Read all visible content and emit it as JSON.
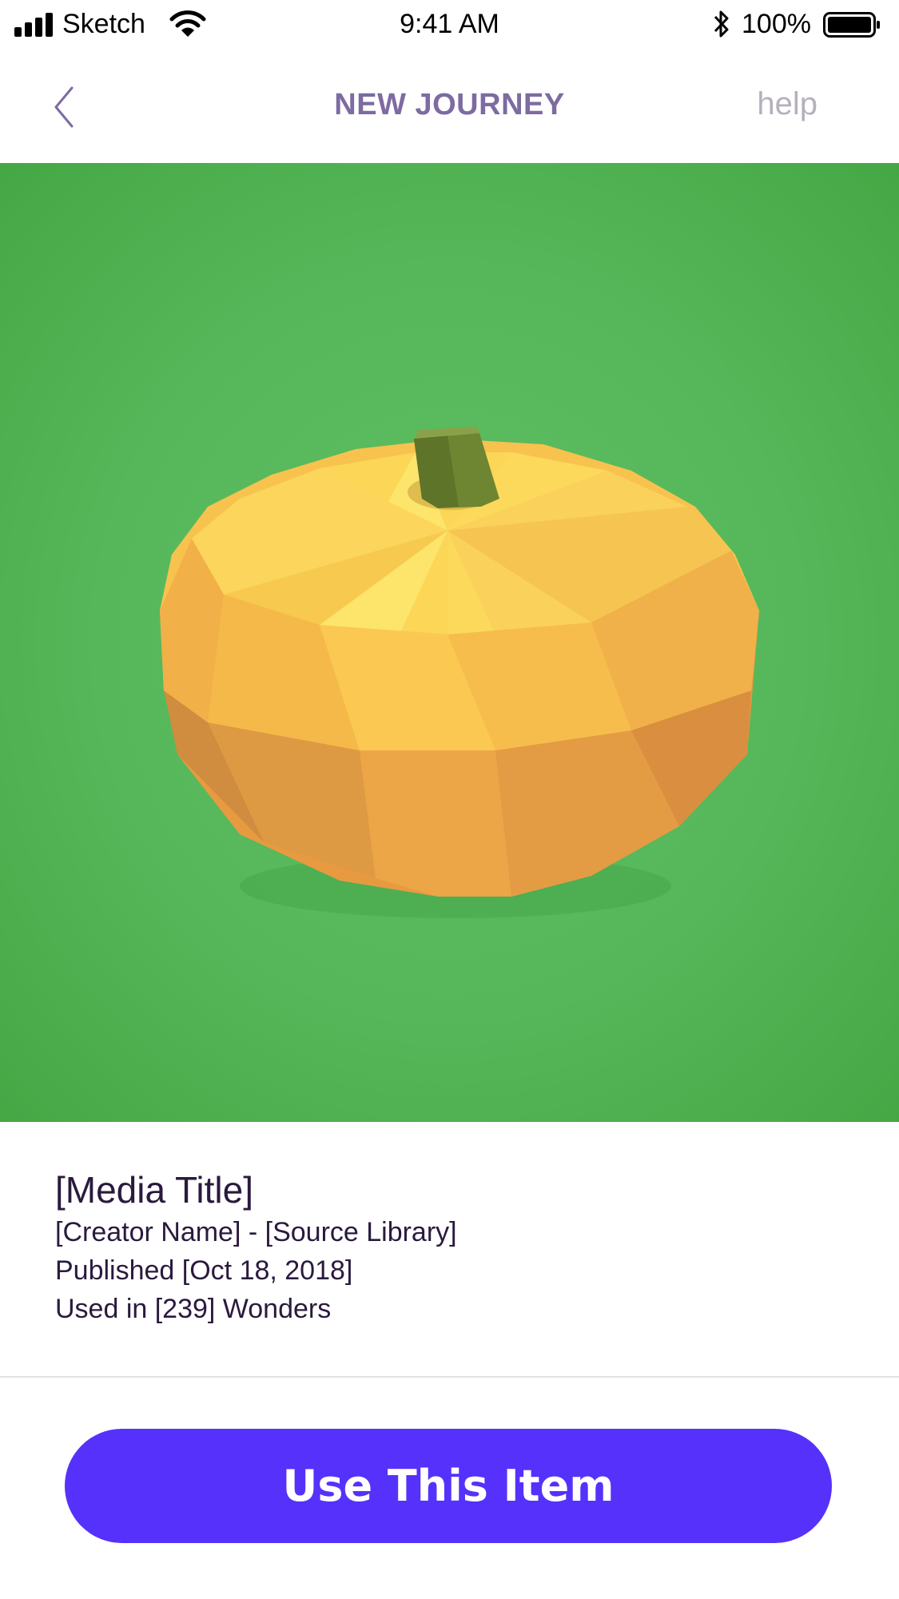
{
  "status_bar": {
    "carrier": "Sketch",
    "time": "9:41 AM",
    "battery_percent": "100%",
    "signal_icon": "signal-bars-icon",
    "wifi_icon": "wifi-icon",
    "bluetooth_icon": "bluetooth-icon",
    "battery_icon": "battery-icon",
    "battery_level": 1.0
  },
  "nav": {
    "back_icon": "chevron-left-icon",
    "title": "NEW JOURNEY",
    "help_label": "help"
  },
  "media": {
    "background_color": "#56b75a",
    "subject": "pumpkin"
  },
  "info": {
    "title": "[Media Title]",
    "creator_line": "[Creator Name] - [Source Library]",
    "published": "Published [Oct 18, 2018]",
    "usage": "Used in [239] Wonders"
  },
  "action": {
    "use_label": "Use This Item",
    "color": "#5631fb"
  }
}
